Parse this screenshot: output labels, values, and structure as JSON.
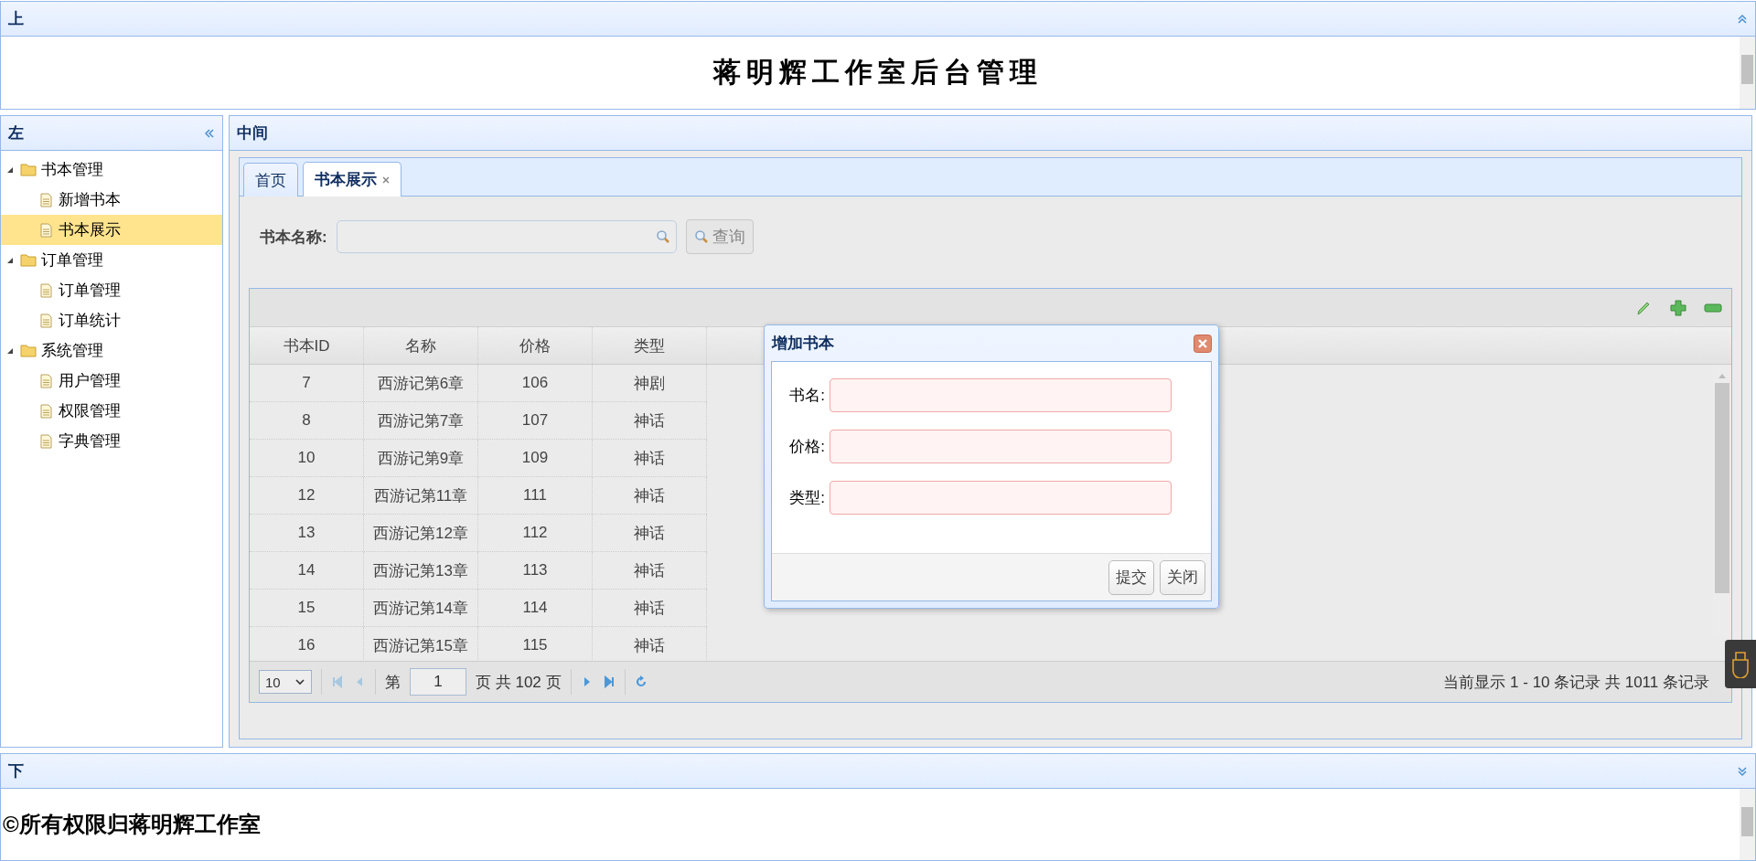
{
  "top": {
    "title": "上",
    "banner": "蒋明辉工作室后台管理"
  },
  "left": {
    "title": "左",
    "tree": [
      {
        "label": "书本管理",
        "expanded": true,
        "selected": false,
        "children": [
          {
            "label": "新增书本",
            "selected": false
          },
          {
            "label": "书本展示",
            "selected": true
          }
        ]
      },
      {
        "label": "订单管理",
        "expanded": true,
        "selected": false,
        "children": [
          {
            "label": "订单管理",
            "selected": false
          },
          {
            "label": "订单统计",
            "selected": false
          }
        ]
      },
      {
        "label": "系统管理",
        "expanded": true,
        "selected": false,
        "children": [
          {
            "label": "用户管理",
            "selected": false
          },
          {
            "label": "权限管理",
            "selected": false
          },
          {
            "label": "字典管理",
            "selected": false
          }
        ]
      }
    ]
  },
  "center": {
    "title": "中间",
    "tabs": [
      {
        "label": "首页",
        "selected": false,
        "closable": false
      },
      {
        "label": "书本展示",
        "selected": true,
        "closable": true
      }
    ],
    "search": {
      "label": "书本名称:",
      "button": "查询"
    },
    "grid": {
      "columns": [
        "书本ID",
        "名称",
        "价格",
        "类型"
      ],
      "rows": [
        [
          "7",
          "西游记第6章",
          "106",
          "神剧"
        ],
        [
          "8",
          "西游记第7章",
          "107",
          "神话"
        ],
        [
          "10",
          "西游记第9章",
          "109",
          "神话"
        ],
        [
          "12",
          "西游记第11章",
          "111",
          "神话"
        ],
        [
          "13",
          "西游记第12章",
          "112",
          "神话"
        ],
        [
          "14",
          "西游记第13章",
          "113",
          "神话"
        ],
        [
          "15",
          "西游记第14章",
          "114",
          "神话"
        ],
        [
          "16",
          "西游记第15章",
          "115",
          "神话"
        ]
      ],
      "pager": {
        "page_size": "10",
        "page_prefix": "第",
        "page": "1",
        "page_suffix": "页 共 102 页",
        "summary": "当前显示 1 - 10 条记录 共 1011 条记录"
      }
    },
    "dialog": {
      "title": "增加书本",
      "fields": [
        {
          "label": "书名:"
        },
        {
          "label": "价格:"
        },
        {
          "label": "类型:"
        }
      ],
      "buttons": [
        "提交",
        "关闭"
      ]
    }
  },
  "bottom": {
    "title": "下",
    "footer": "©所有权限归蒋明辉工作室"
  }
}
